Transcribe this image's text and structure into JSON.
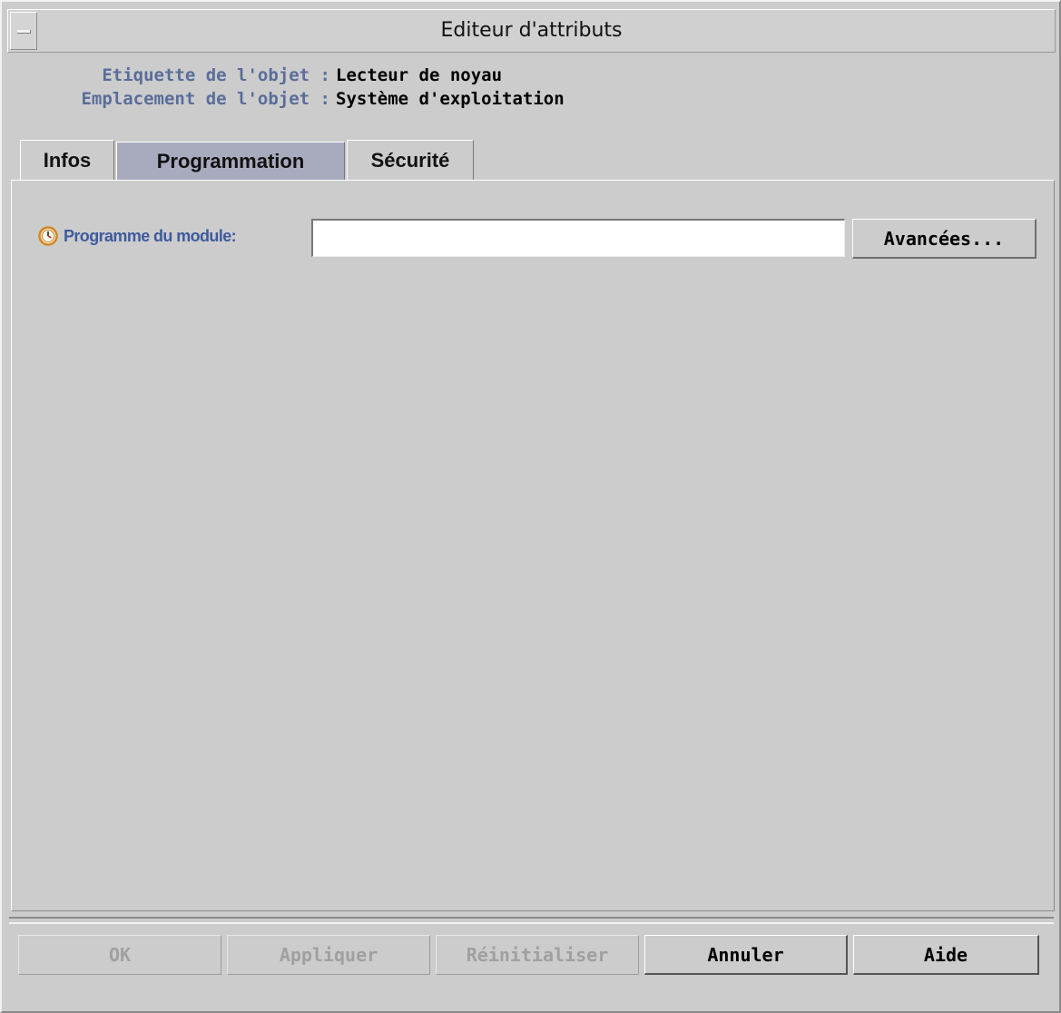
{
  "window": {
    "title": "Editeur d'attributs"
  },
  "object_info": {
    "label_caption": "Etiquette de l'objet :",
    "label_value": "Lecteur de noyau",
    "location_caption": "Emplacement de l'objet :",
    "location_value": "Système d'exploitation"
  },
  "tabs": [
    {
      "label": "Infos",
      "active": false
    },
    {
      "label": "Programmation",
      "active": true
    },
    {
      "label": "Sécurité",
      "active": false
    }
  ],
  "schedule": {
    "icon": "clock-icon",
    "label": "Programme du module:",
    "value": "",
    "advanced_button": "Avancées..."
  },
  "footer": {
    "ok": "OK",
    "apply": "Appliquer",
    "reset": "Réinitialiser",
    "cancel": "Annuler",
    "help": "Aide"
  },
  "colors": {
    "label_blue": "#5a6d9a",
    "active_tab": "#a8abbe",
    "clock_orange": "#e8a23a"
  }
}
